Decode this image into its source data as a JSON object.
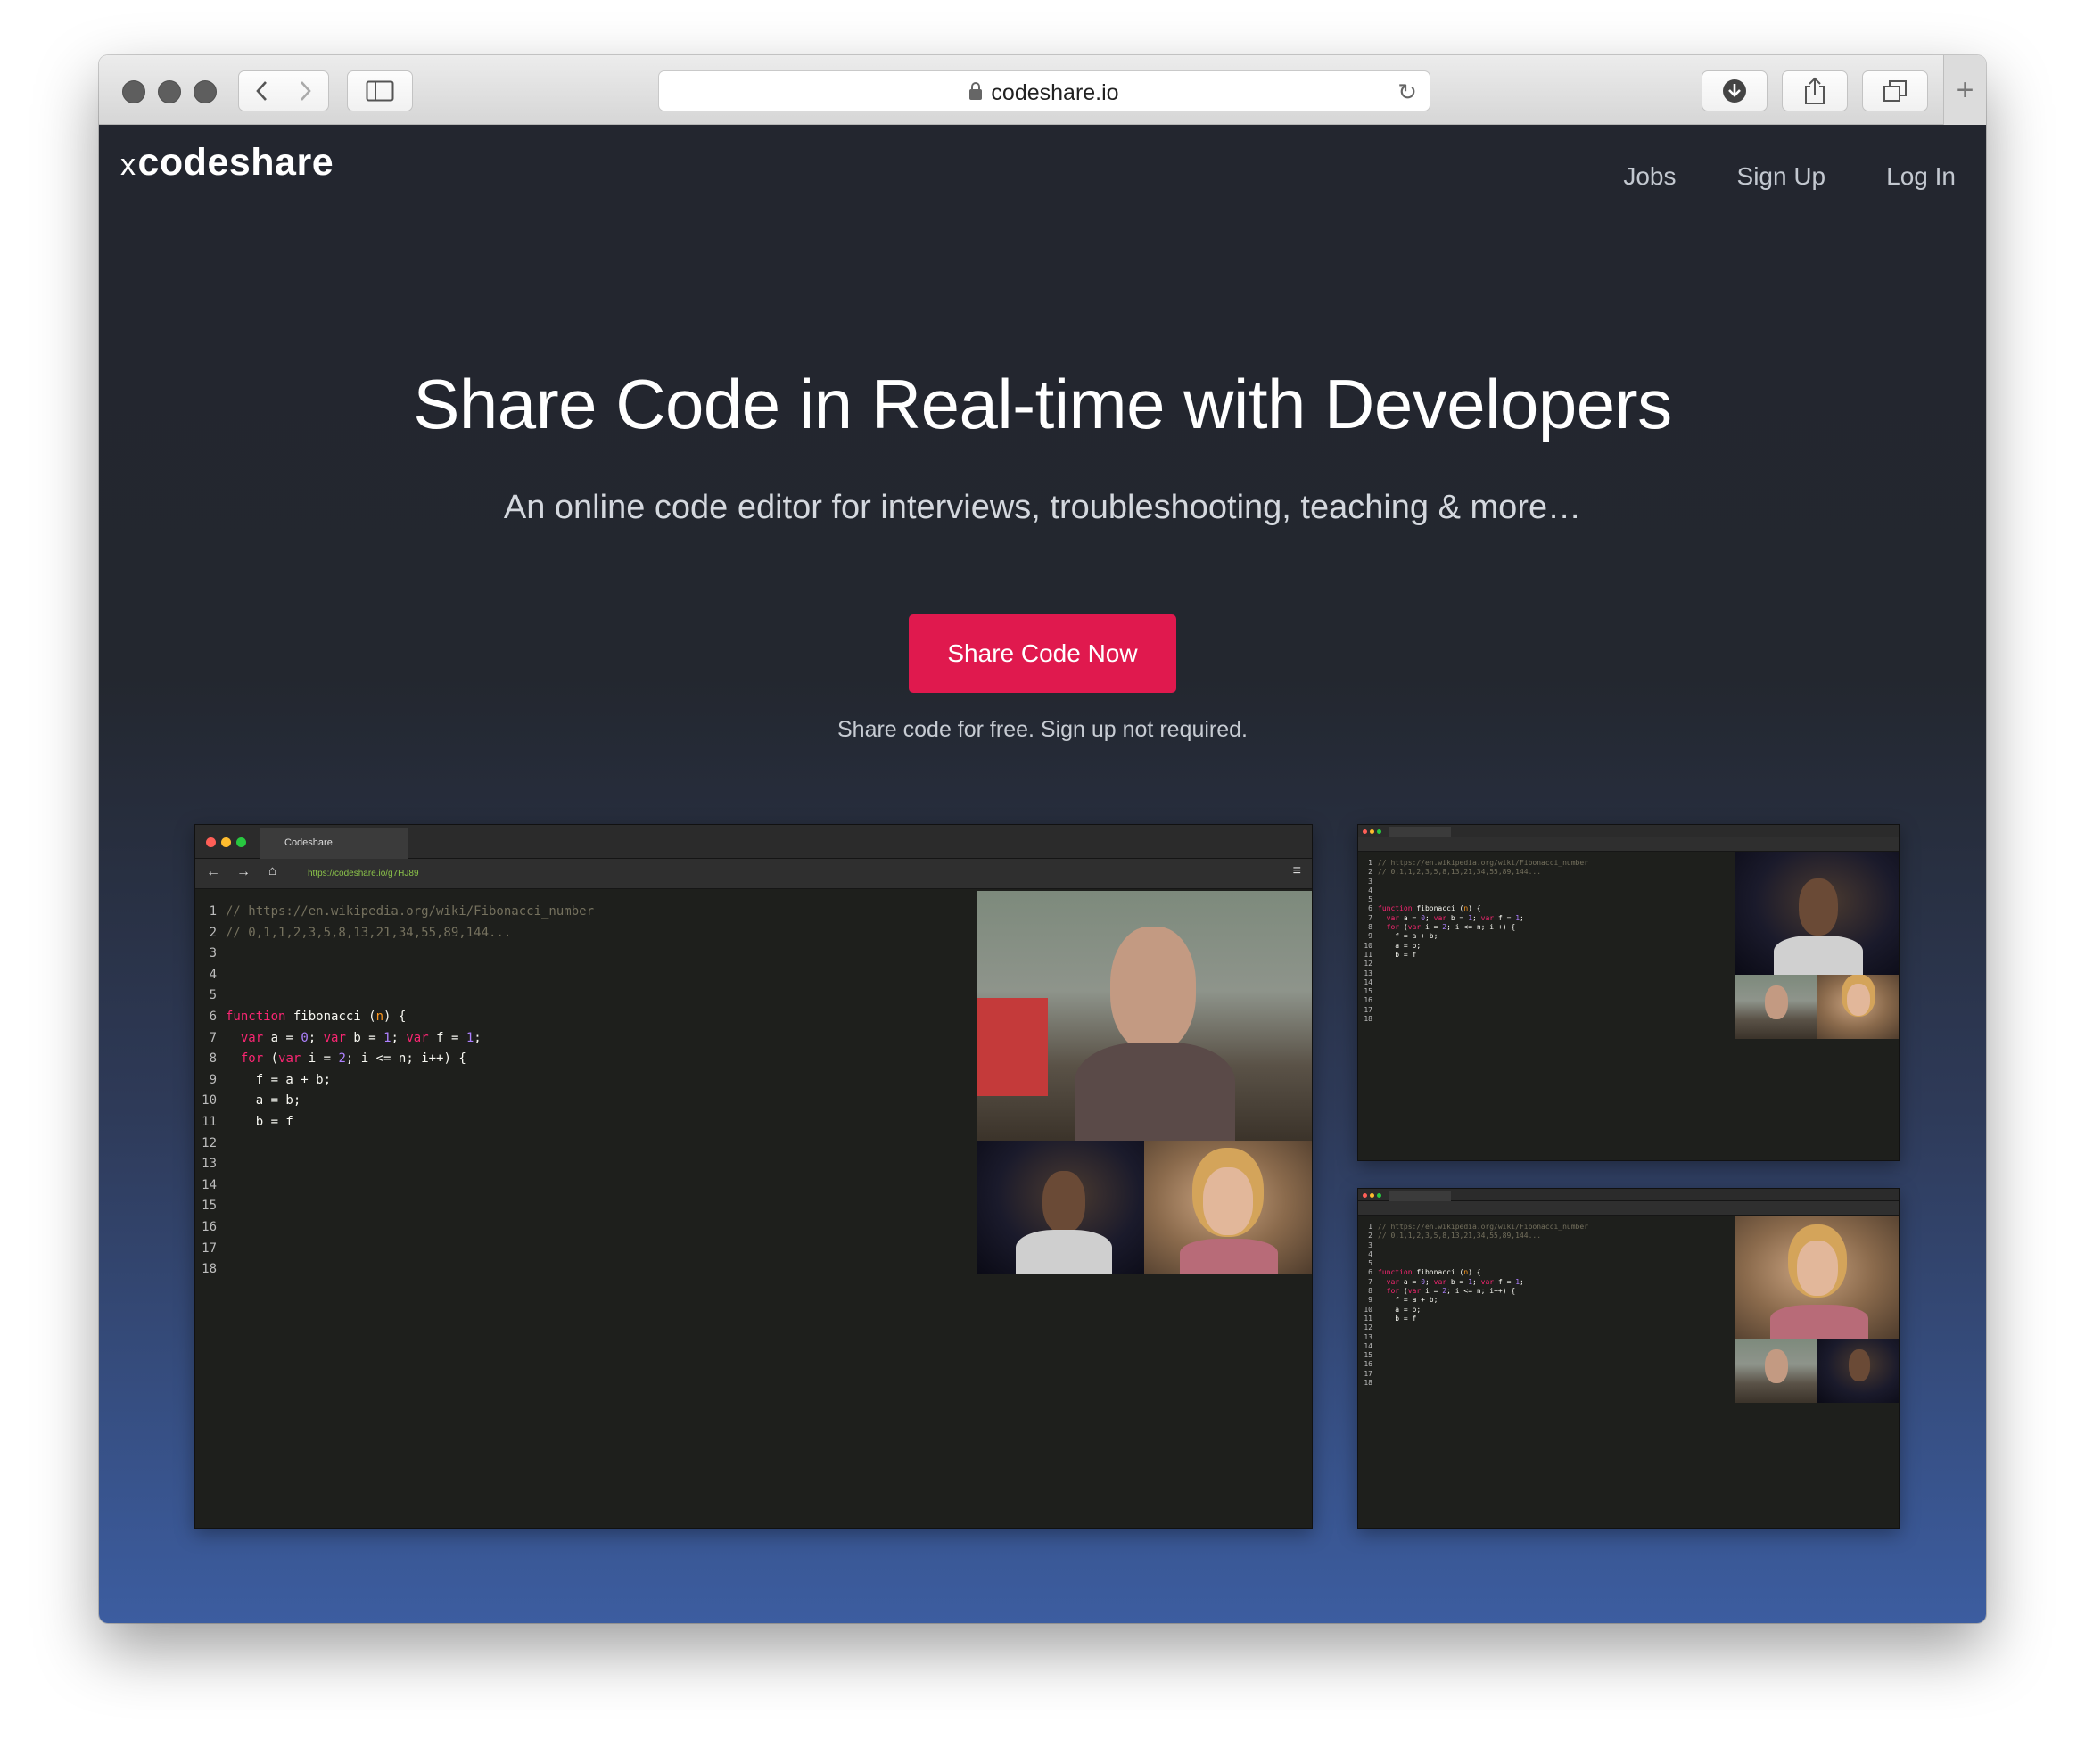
{
  "browser": {
    "url": "codeshare.io",
    "buttons": [
      "back",
      "forward",
      "sidebar",
      "downloads",
      "share",
      "tabs",
      "new-tab"
    ]
  },
  "site": {
    "logo_mark": "x",
    "logo_text": "codeshare",
    "nav": {
      "jobs": "Jobs",
      "signup": "Sign Up",
      "login": "Log In"
    }
  },
  "hero": {
    "title": "Share Code in Real-time with Developers",
    "subtitle": "An online code editor for interviews, troubleshooting, teaching & more…",
    "cta": "Share Code Now",
    "note": "Share code for free. Sign up not required."
  },
  "preview": {
    "tab_title": "Codeshare",
    "url": "https://codeshare.io/g7HJ89",
    "line_numbers": [
      "1",
      "2",
      "3",
      "4",
      "5",
      "6",
      "7",
      "8",
      "9",
      "10",
      "11",
      "12",
      "13",
      "14",
      "15",
      "16",
      "17",
      "18"
    ],
    "code_lines": [
      "// https://en.wikipedia.org/wiki/Fibonacci_number",
      "// 0,1,1,2,3,5,8,13,21,34,55,89,144...",
      "",
      "",
      "",
      "function fibonacci (n) {",
      "  var a = 0; var b = 1; var f = 1;",
      "  for (var i = 2; i <= n; i++) {",
      "    f = a + b;",
      "    a = b;",
      "    b = f",
      "",
      "",
      "",
      "",
      "",
      "",
      ""
    ]
  },
  "colors": {
    "accent": "#e0194e",
    "page_top": "#23262f",
    "page_bottom": "#3c5da0"
  }
}
